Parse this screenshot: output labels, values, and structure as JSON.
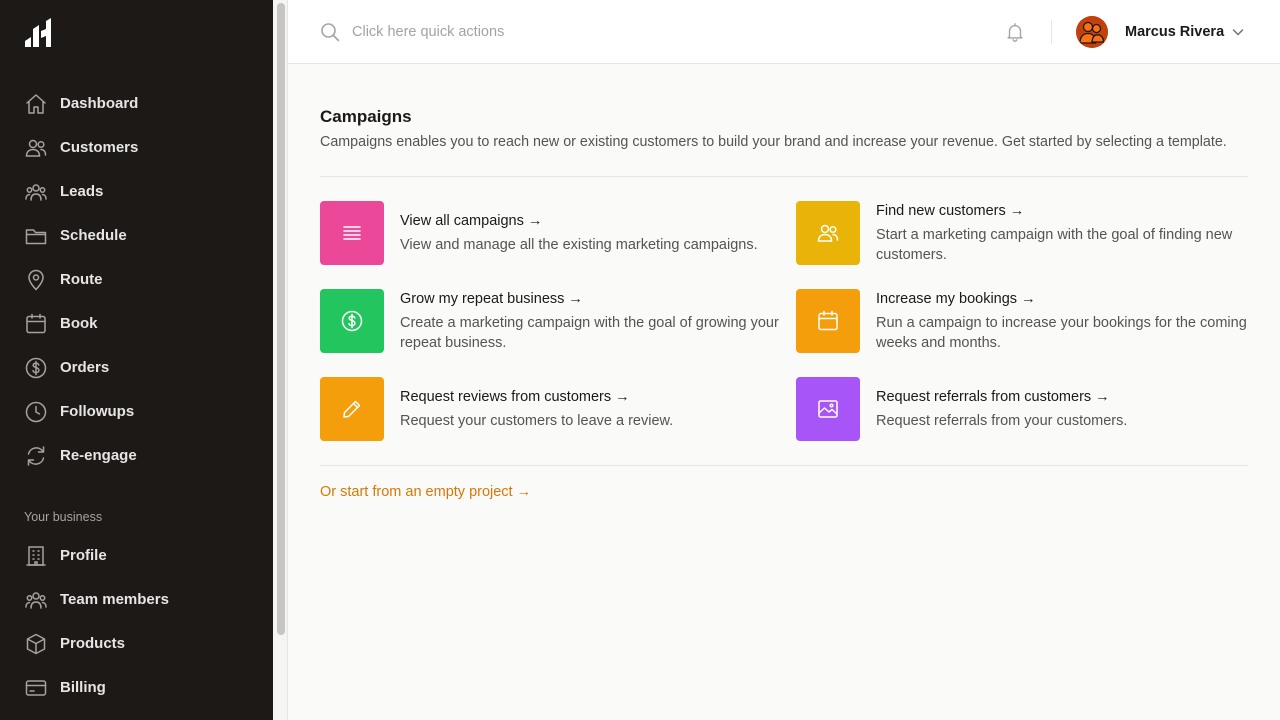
{
  "sidebar": {
    "logo_icon": "brand-logo-icon",
    "items": [
      {
        "label": "Dashboard",
        "icon": "home-icon"
      },
      {
        "label": "Customers",
        "icon": "users-icon"
      },
      {
        "label": "Leads",
        "icon": "user-group-icon"
      },
      {
        "label": "Schedule",
        "icon": "folder-icon"
      },
      {
        "label": "Route",
        "icon": "map-pin-icon"
      },
      {
        "label": "Book",
        "icon": "calendar-icon"
      },
      {
        "label": "Orders",
        "icon": "dollar-circle-icon"
      },
      {
        "label": "Followups",
        "icon": "clock-icon"
      },
      {
        "label": "Re-engage",
        "icon": "refresh-icon"
      }
    ],
    "section_title": "Your business",
    "business_items": [
      {
        "label": "Profile",
        "icon": "building-icon"
      },
      {
        "label": "Team members",
        "icon": "user-group-icon"
      },
      {
        "label": "Products",
        "icon": "cube-icon"
      },
      {
        "label": "Billing",
        "icon": "credit-card-icon"
      }
    ]
  },
  "header": {
    "search_placeholder": "Click here quick actions",
    "user_name": "Marcus Rivera"
  },
  "main": {
    "title": "Campaigns",
    "description": "Campaigns enables you to reach new or existing customers to build your brand and increase your revenue. Get started by selecting a template.",
    "templates": [
      {
        "title": "View all campaigns →",
        "desc": "View and manage all the existing marketing campaigns.",
        "color": "#ec4899",
        "icon": "list-icon"
      },
      {
        "title": "Find new customers →",
        "desc": "Start a marketing campaign with the goal of finding new customers.",
        "color": "#eab308",
        "icon": "users-icon"
      },
      {
        "title": "Grow my repeat business →",
        "desc": "Create a marketing campaign with the goal of growing your repeat business.",
        "color": "#22c55e",
        "icon": "dollar-circle-icon"
      },
      {
        "title": "Increase my bookings →",
        "desc": "Run a campaign to increase your bookings for the coming weeks and months.",
        "color": "#f59e0b",
        "icon": "calendar-icon"
      },
      {
        "title": "Request reviews from customers →",
        "desc": "Request your customers to leave a review.",
        "color": "#f59e0b",
        "icon": "pencil-icon"
      },
      {
        "title": "Request referrals from customers →",
        "desc": "Request referrals from your customers.",
        "color": "#a855f7",
        "icon": "photo-icon"
      }
    ],
    "empty_link": "Or start from an empty project →",
    "link_color": "#d97706"
  }
}
